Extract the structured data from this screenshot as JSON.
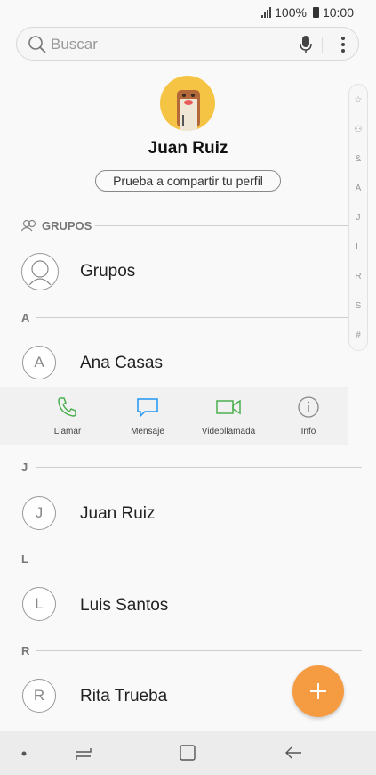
{
  "status_bar": {
    "battery": "100%",
    "time": "10:00"
  },
  "search": {
    "placeholder": "Buscar"
  },
  "profile": {
    "name": "Juan Ruiz",
    "share_label": "Prueba a compartir tu perfil"
  },
  "groups_section": {
    "title": "GRUPOS",
    "item_label": "Grupos"
  },
  "index_bar": {
    "letters": [
      "☆",
      "⚇",
      "&",
      "A",
      "J",
      "L",
      "R",
      "S",
      "#"
    ]
  },
  "sections": [
    {
      "letter": "A",
      "contacts": [
        {
          "initial": "A",
          "name": "Ana Casas"
        }
      ]
    },
    {
      "letter": "J",
      "contacts": [
        {
          "initial": "J",
          "name": "Juan Ruiz"
        }
      ]
    },
    {
      "letter": "L",
      "contacts": [
        {
          "initial": "L",
          "name": "Luis Santos"
        }
      ]
    },
    {
      "letter": "R",
      "contacts": [
        {
          "initial": "R",
          "name": "Rita Trueba"
        }
      ]
    }
  ],
  "actions": [
    {
      "label": "Llamar",
      "icon": "phone-icon",
      "color": "#4caf50"
    },
    {
      "label": "Mensaje",
      "icon": "message-icon",
      "color": "#2196f3"
    },
    {
      "label": "Videollamada",
      "icon": "video-icon",
      "color": "#4caf50"
    },
    {
      "label": "Info",
      "icon": "info-icon",
      "color": "#888888"
    }
  ],
  "fab": {
    "icon": "plus-icon",
    "color": "#f59b42"
  },
  "nav_bar": {
    "icons": [
      "dot-icon",
      "recents-icon",
      "home-icon",
      "back-icon"
    ]
  }
}
